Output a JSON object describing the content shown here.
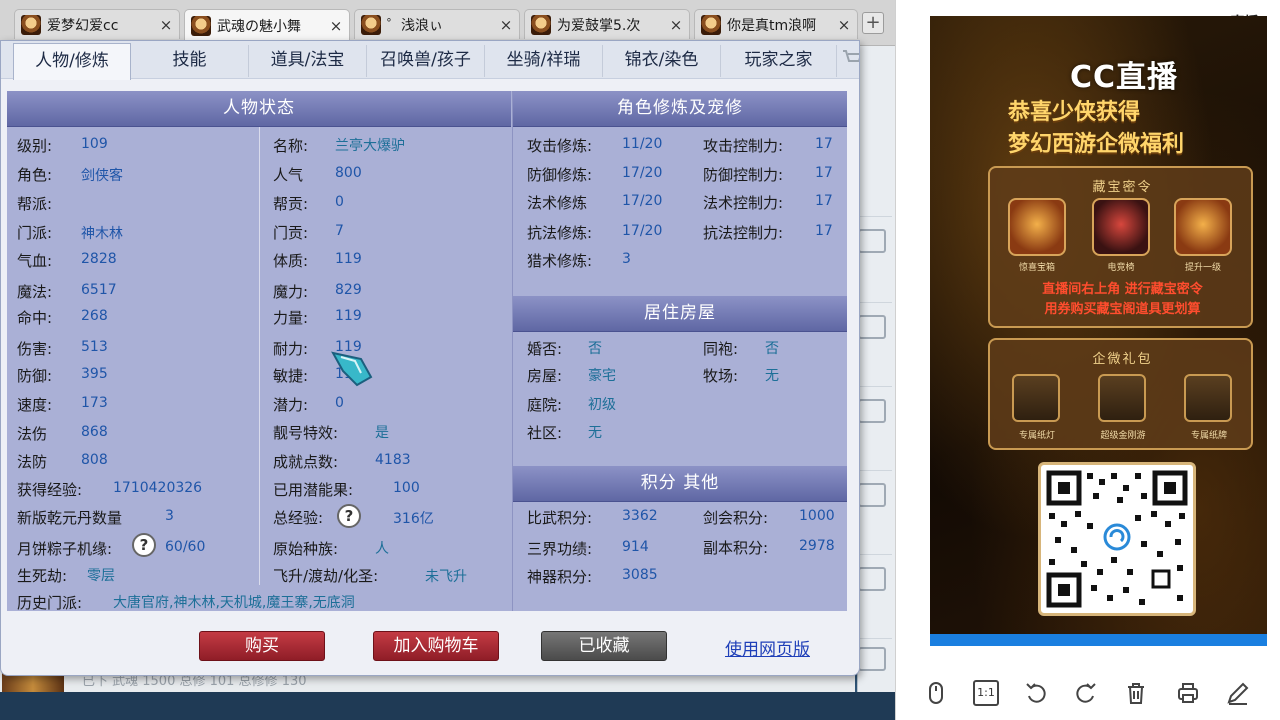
{
  "browser": {
    "tabs": [
      {
        "title": "爱梦幻爱cc",
        "active": false
      },
      {
        "title": "武魂の魅小舞",
        "active": true
      },
      {
        "title": "゜浅浪ぃ",
        "active": false
      },
      {
        "title": "为爱鼓掌5.次",
        "active": false
      },
      {
        "title": "你是真tm浪啊",
        "active": false
      }
    ],
    "close_glyph": "×",
    "new_tab_glyph": "+"
  },
  "background": {
    "footer_text": "已下 武魂 1500 总修 101 总修修 130"
  },
  "dialog": {
    "tabs": [
      "人物/修炼",
      "技能",
      "道具/法宝",
      "召唤兽/孩子",
      "坐骑/祥瑞",
      "锦衣/染色",
      "玩家之家"
    ],
    "status": {
      "title": "人物状态",
      "left": [
        {
          "label": "级别:",
          "value": "109"
        },
        {
          "label": "角色:",
          "value": "剑侠客"
        },
        {
          "label": "帮派:",
          "value": ""
        },
        {
          "label": "门派:",
          "value": "神木林"
        },
        {
          "label": "气血:",
          "value": "2828"
        },
        {
          "label": "魔法:",
          "value": "6517"
        },
        {
          "label": "命中:",
          "value": "268"
        },
        {
          "label": "伤害:",
          "value": "513"
        },
        {
          "label": "防御:",
          "value": "395"
        },
        {
          "label": "速度:",
          "value": "173"
        },
        {
          "label": "法伤",
          "value": "868"
        },
        {
          "label": "法防",
          "value": "808"
        },
        {
          "label": "获得经验:",
          "value": "1710420326"
        },
        {
          "label": "新版乾元丹数量",
          "value": "3"
        },
        {
          "label": "月饼粽子机缘:",
          "value": "60/60"
        },
        {
          "label": "生死劫:",
          "value": "零层"
        }
      ],
      "right": [
        {
          "label": "名称:",
          "value": "兰亭大爆驴"
        },
        {
          "label": "人气",
          "value": "800"
        },
        {
          "label": "帮贡:",
          "value": "0"
        },
        {
          "label": "门贡:",
          "value": "7"
        },
        {
          "label": "体质:",
          "value": "119"
        },
        {
          "label": "魔力:",
          "value": "829"
        },
        {
          "label": "力量:",
          "value": "119"
        },
        {
          "label": "耐力:",
          "value": "119"
        },
        {
          "label": "敏捷:",
          "value": "119"
        },
        {
          "label": "潜力:",
          "value": "0"
        },
        {
          "label": "靓号特效:",
          "value": "是"
        },
        {
          "label": "成就点数:",
          "value": "4183"
        },
        {
          "label": "已用潜能果:",
          "value": "100"
        },
        {
          "label": "总经验:",
          "value": "316亿"
        },
        {
          "label": "原始种族:",
          "value": "人"
        },
        {
          "label": "飞升/渡劫/化圣:",
          "value": "未飞升"
        }
      ],
      "history_label": "历史门派:",
      "history_value": "大唐官府,神木林,天机城,魔王寨,无底洞",
      "question_glyph": "?"
    },
    "cultivation": {
      "title": "角色修炼及宠修",
      "rows": [
        {
          "label": "攻击修炼:",
          "value": "11/20",
          "label2": "攻击控制力:",
          "value2": "17"
        },
        {
          "label": "防御修炼:",
          "value": "17/20",
          "label2": "防御控制力:",
          "value2": "17"
        },
        {
          "label": "法术修炼",
          "value": "17/20",
          "label2": "法术控制力:",
          "value2": "17"
        },
        {
          "label": "抗法修炼:",
          "value": "17/20",
          "label2": "抗法控制力:",
          "value2": "17"
        },
        {
          "label": "猎术修炼:",
          "value": "3",
          "label2": "",
          "value2": ""
        }
      ]
    },
    "housing": {
      "title": "居住房屋",
      "rows": [
        {
          "label": "婚否:",
          "value": "否",
          "label2": "同袍:",
          "value2": "否"
        },
        {
          "label": "房屋:",
          "value": "豪宅",
          "label2": "牧场:",
          "value2": "无"
        },
        {
          "label": "庭院:",
          "value": "初级",
          "label2": "",
          "value2": ""
        },
        {
          "label": "社区:",
          "value": "无",
          "label2": "",
          "value2": ""
        }
      ]
    },
    "points": {
      "title": "积分 其他",
      "rows": [
        {
          "label": "比武积分:",
          "value": "3362",
          "label2": "剑会积分:",
          "value2": "1000"
        },
        {
          "label": "三界功绩:",
          "value": "914",
          "label2": "副本积分:",
          "value2": "2978"
        },
        {
          "label": "神器积分:",
          "value": "3085",
          "label2": "",
          "value2": ""
        }
      ]
    },
    "buttons": {
      "buy": "购买",
      "add_cart": "加入购物车",
      "favorited": "已收藏",
      "web_version": "使用网页版"
    }
  },
  "live": {
    "watermark": "©CC直播",
    "logo": "CC直播",
    "promo_title_1": "恭喜少侠获得",
    "promo_title_2": "梦幻西游企微福利",
    "card1_title": "藏宝密令",
    "card1_items": [
      "惊喜宝箱",
      "电竞椅",
      "提升一级"
    ],
    "card1_text_1": "直播间右上角 进行藏宝密令",
    "card1_text_2": "用券购买藏宝阁道具更划算",
    "card2_title": "企微礼包",
    "card2_items": [
      "专属纸灯",
      "超级金刚游",
      "专属纸牌"
    ]
  },
  "toolbar": {
    "icons": [
      "mouse-icon",
      "actual-size-icon",
      "rotate-left-icon",
      "rotate-right-icon",
      "delete-icon",
      "print-icon",
      "edit-icon"
    ],
    "actual_size_label": "1:1"
  },
  "colors": {
    "panel_header": "#6f76b3",
    "panel_body": "#aab0d6",
    "value_blue": "#1f55a8",
    "button_red": "#a82833",
    "button_gray": "#5a5a5a",
    "link": "#1f3fb8",
    "promo_gold": "#ffd56b"
  }
}
